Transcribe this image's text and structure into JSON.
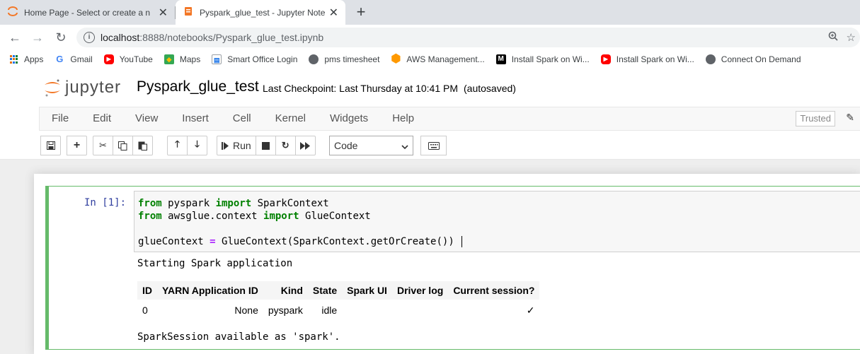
{
  "browser": {
    "tabs": [
      {
        "title": "Home Page - Select or create a n",
        "icon": "jupyter-favicon",
        "active": false
      },
      {
        "title": "Pyspark_glue_test - Jupyter Note",
        "icon": "notebook-favicon",
        "active": true
      }
    ],
    "new_tab_label": "+",
    "url_host": "localhost",
    "url_rest": ":8888/notebooks/Pyspark_glue_test.ipynb",
    "bookmarks": [
      {
        "label": "Apps",
        "icon": "apps-grid-icon"
      },
      {
        "label": "Gmail",
        "icon": "google-icon",
        "color": "#4285f4",
        "glyph": "G"
      },
      {
        "label": "YouTube",
        "icon": "youtube-icon",
        "color": "#ff0000",
        "glyph": "▶"
      },
      {
        "label": "Maps",
        "icon": "maps-icon",
        "color": "#34a853",
        "glyph": "◆"
      },
      {
        "label": "Smart Office Login",
        "icon": "document-icon",
        "color": "#9aa0a6",
        "glyph": "▤"
      },
      {
        "label": "pms timesheet",
        "icon": "globe-icon",
        "color": "#5f6368",
        "glyph": "●"
      },
      {
        "label": "AWS Management...",
        "icon": "aws-icon",
        "color": "#ff9900",
        "glyph": "⬢"
      },
      {
        "label": "Install Spark on Wi...",
        "icon": "medium-icon",
        "color": "#000000",
        "glyph": "M"
      },
      {
        "label": "Install Spark on Wi...",
        "icon": "youtube-icon",
        "color": "#ff0000",
        "glyph": "▶"
      },
      {
        "label": "Connect On Demand",
        "icon": "globe-icon",
        "color": "#5f6368",
        "glyph": "●"
      }
    ]
  },
  "jupyter": {
    "logo_text": "jupyter",
    "notebook_name": "Pyspark_glue_test",
    "checkpoint": "Last Checkpoint: Last Thursday at 10:41 PM",
    "autosaved": "(autosaved)",
    "menu": [
      "File",
      "Edit",
      "View",
      "Insert",
      "Cell",
      "Kernel",
      "Widgets",
      "Help"
    ],
    "trusted": "Trusted",
    "run_label": "Run",
    "cell_type": "Code"
  },
  "cell": {
    "prompt": "In [1]:",
    "code": {
      "l1_kw1": "from",
      "l1_mod": " pyspark ",
      "l1_kw2": "import",
      "l1_name": " SparkContext",
      "l2_kw1": "from",
      "l2_mod": " awsglue.context ",
      "l2_kw2": "import",
      "l2_name": " GlueContext",
      "l4_lhs": "glueContext ",
      "l4_op": "=",
      "l4_rhs": " GlueContext(SparkContext.getOrCreate())"
    },
    "output_first": "Starting Spark application",
    "table_headers": [
      "ID",
      "YARN Application ID",
      "Kind",
      "State",
      "Spark UI",
      "Driver log",
      "Current session?"
    ],
    "table_row": [
      "0",
      "None",
      "pyspark",
      "idle",
      "",
      "",
      "✓"
    ],
    "output_last": "SparkSession available as 'spark'."
  }
}
